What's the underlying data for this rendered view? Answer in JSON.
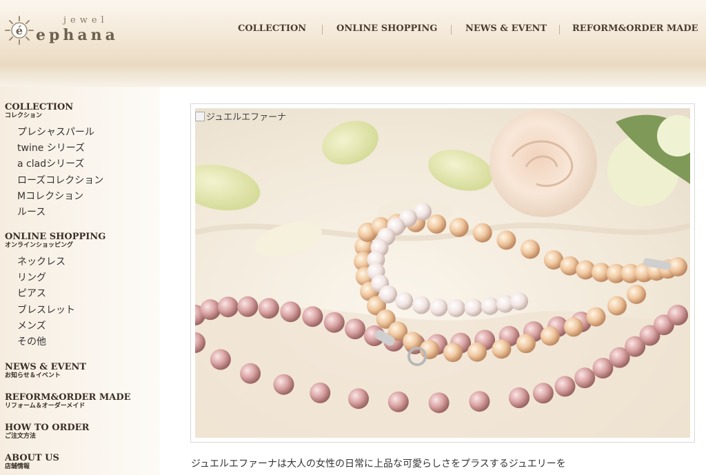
{
  "brand": {
    "jewel": "jewel",
    "name": "ephana"
  },
  "global_nav": {
    "items": [
      {
        "label": "COLLECTION"
      },
      {
        "label": "ONLINE SHOPPING"
      },
      {
        "label": "NEWS & EVENT"
      },
      {
        "label": "REFORM&ORDER MADE"
      }
    ]
  },
  "sidebar": {
    "collection": {
      "title": "COLLECTION",
      "sub": "コレクション",
      "items": [
        "プレシャスパール",
        "twine シリーズ",
        "a cladシリーズ",
        "ローズコレクション",
        "Mコレクション",
        "ルース"
      ]
    },
    "online_shopping": {
      "title": "ONLINE SHOPPING",
      "sub": "オンラインショッピング",
      "items": [
        "ネックレス",
        "リング",
        "ピアス",
        "ブレスレット",
        "メンズ",
        "その他"
      ]
    },
    "news_event": {
      "title": "NEWS & EVENT",
      "sub": "お知らせ＆イベント"
    },
    "reform": {
      "title": "REFORM&ORDER MADE",
      "sub": "リフォーム＆オーダーメイド"
    },
    "how_to_order": {
      "title": "HOW TO ORDER",
      "sub": "ご注文方法"
    },
    "about_us": {
      "title": "ABOUT US",
      "sub": "店舗情報"
    }
  },
  "main": {
    "image_alt": "ジュエルエファーナ",
    "intro_text": "ジュエルエファーナは大人の女性の日常に上品な可愛らしさをプラスするジュエリーを"
  }
}
